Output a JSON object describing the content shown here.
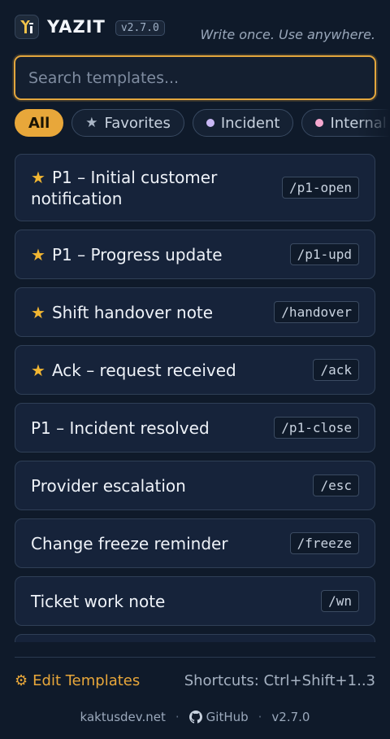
{
  "header": {
    "brand": "YAZIT",
    "version": "v2.7.0",
    "tagline": "Write once. Use anywhere."
  },
  "search": {
    "placeholder": "Search templates...",
    "value": ""
  },
  "filters": [
    {
      "label": "All",
      "active": true
    },
    {
      "label": "Favorites",
      "icon": "star-icon"
    },
    {
      "label": "Incident",
      "dot_color": "#c9b8f5"
    },
    {
      "label": "Internal",
      "dot_color": "#f5a8cf"
    }
  ],
  "templates": [
    {
      "title": "P1 – Initial customer notification",
      "shortcut": "/p1-open",
      "favorite": true
    },
    {
      "title": "P1 – Progress update",
      "shortcut": "/p1-upd",
      "favorite": true
    },
    {
      "title": "Shift handover note",
      "shortcut": "/handover",
      "favorite": true
    },
    {
      "title": "Ack – request received",
      "shortcut": "/ack",
      "favorite": true
    },
    {
      "title": "P1 – Incident resolved",
      "shortcut": "/p1-close",
      "favorite": false
    },
    {
      "title": "Provider escalation",
      "shortcut": "/esc",
      "favorite": false
    },
    {
      "title": "Change freeze reminder",
      "shortcut": "/freeze",
      "favorite": false
    },
    {
      "title": "Ticket work note",
      "shortcut": "/wn",
      "favorite": false
    }
  ],
  "footer": {
    "edit_label": "Edit Templates",
    "shortcuts_hint": "Shortcuts: Ctrl+Shift+1..3"
  },
  "bottom": {
    "site": "kaktusdev.net",
    "github": "GitHub",
    "version": "v2.7.0"
  },
  "colors": {
    "accent": "#e8a73a",
    "favorite_star": "#f2b632",
    "background": "#0f1a2a"
  }
}
